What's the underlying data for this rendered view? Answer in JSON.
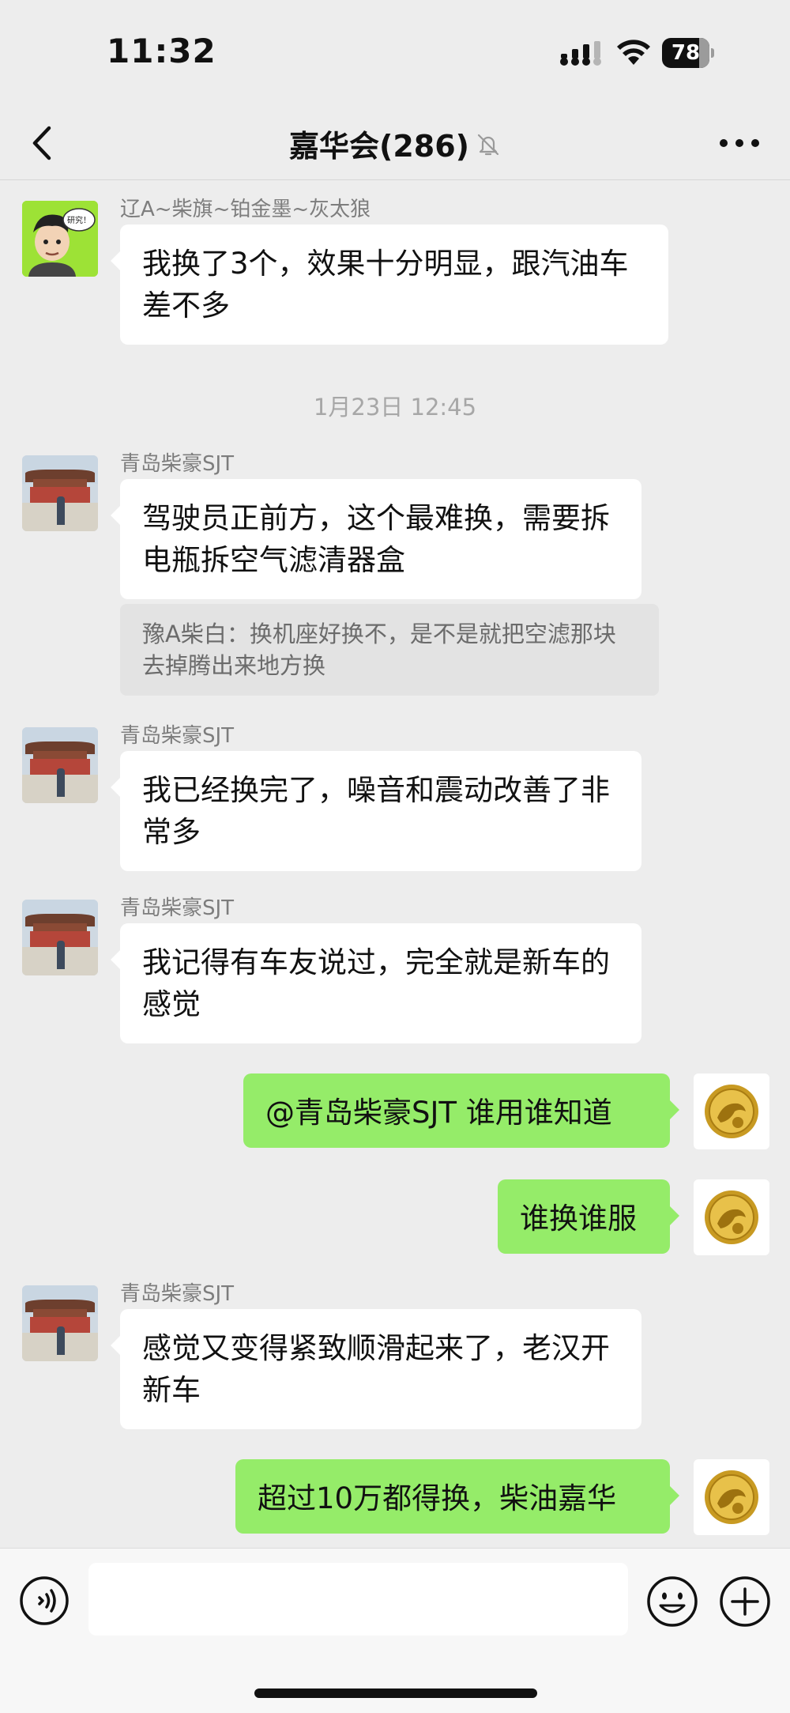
{
  "status_bar": {
    "time": "11:32",
    "battery_level": "78",
    "battery_percent": 78,
    "signal_icon": "signal-bars-icon",
    "wifi_icon": "wifi-icon"
  },
  "nav": {
    "title": "嘉华会(286)",
    "back_icon": "chevron-left-icon",
    "mute_icon": "bell-slash-icon",
    "more_icon": "more-dots-icon"
  },
  "messages": [
    {
      "direction": "in",
      "sender": "辽A~柴旗~铂金墨~灰太狼",
      "text": "我换了3个，效果十分明显，跟汽油车差不多",
      "avatar_caption": "研究！"
    },
    {
      "type": "timestamp",
      "text": "1月23日 12:45"
    },
    {
      "direction": "in",
      "sender": "青岛柴豪SJT",
      "text": "驾驶员正前方，这个最难换，需要拆电瓶拆空气滤清器盒",
      "quote": "豫A柴白：换机座好换不，是不是就把空滤那块去掉腾出来地方换"
    },
    {
      "direction": "in",
      "sender": "青岛柴豪SJT",
      "text": "我已经换完了，噪音和震动改善了非常多"
    },
    {
      "direction": "in",
      "sender": "青岛柴豪SJT",
      "text": "我记得有车友说过，完全就是新车的感觉"
    },
    {
      "direction": "out",
      "text": "@青岛柴豪SJT 谁用谁知道"
    },
    {
      "direction": "out",
      "text": "谁换谁服"
    },
    {
      "direction": "in",
      "sender": "青岛柴豪SJT",
      "text": "感觉又变得紧致顺滑起来了，老汉开新车"
    },
    {
      "direction": "out",
      "text": "超过10万都得换，柴油嘉华"
    }
  ],
  "input_bar": {
    "placeholder": "",
    "voice_icon": "voice-icon",
    "emoji_icon": "emoji-icon",
    "plus_icon": "plus-icon"
  },
  "colors": {
    "background": "#ededed",
    "outgoing_bubble": "#95ec69",
    "incoming_bubble": "#ffffff",
    "quote_background": "#e3e3e3"
  }
}
